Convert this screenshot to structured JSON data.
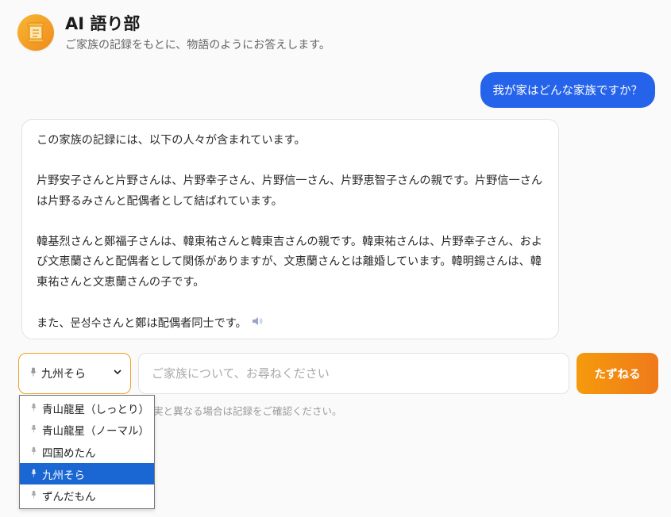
{
  "header": {
    "logo_icon": "scroll-icon",
    "title": "AI 語り部",
    "subtitle": "ご家族の記録をもとに、物語のようにお答えします。"
  },
  "chat": {
    "user_message": "我が家はどんな家族ですか？",
    "bot_paragraphs": [
      "この家族の記録には、以下の人々が含まれています。",
      "片野安子さんと片野さんは、片野幸子さん、片野信一さん、片野恵智子さんの親です。片野信一さんは片野るみさんと配偶者として結ばれています。",
      "韓基烈さんと鄭福子さんは、韓東祐さんと韓東吉さんの親です。韓東祐さんは、片野幸子さん、および文恵蘭さんと配偶者として関係がありますが、文恵蘭さんとは離婚しています。韓明錫さんは、韓東祐さんと文恵蘭さんの子です。",
      "また、문성수さんと鄭は配偶者同士です。"
    ],
    "speaker_icon": "speaker-icon"
  },
  "input_area": {
    "voice_selected": "九州そら",
    "voice_options": [
      "青山龍星（しっとり）",
      "青山龍星（ノーマル）",
      "四国めたん",
      "九州そら",
      "ずんだもん"
    ],
    "question_placeholder": "ご家族について、お尋ねください",
    "ask_button": "たずねる",
    "disclaimer": "実と異なる場合は記録をご確認ください。"
  },
  "colors": {
    "user_bubble": "#2563eb",
    "accent_orange": "#f59a0c",
    "dropdown_selected": "#1a66d2"
  }
}
